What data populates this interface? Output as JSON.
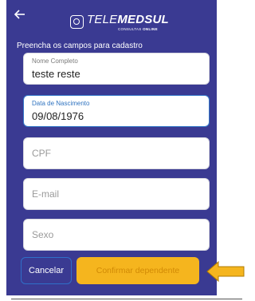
{
  "header": {
    "logo_primary": "TELE",
    "logo_secondary": "MEDSUL",
    "logo_sub_prefix": "CONSULTAS",
    "logo_sub_bold": "ONLINE"
  },
  "form": {
    "title": "Preencha os campos para cadastro",
    "fields": [
      {
        "label": "Nome Completo",
        "value": "teste reste"
      },
      {
        "label": "Data de Nascimento",
        "value": "09/08/1976"
      },
      {
        "placeholder": "CPF"
      },
      {
        "placeholder": "E-mail"
      },
      {
        "placeholder": "Sexo"
      }
    ]
  },
  "actions": {
    "cancel_label": "Cancelar",
    "confirm_label": "Confirmar dependente"
  },
  "icons": {
    "back": "arrow-left-icon",
    "logo": "telemedsul-logo-icon",
    "pointer": "arrow-pointer-icon"
  },
  "colors": {
    "background": "#3a3a92",
    "confirm": "#f5b51e",
    "active_border": "#3478c8",
    "arrow": "#f5b51e"
  }
}
